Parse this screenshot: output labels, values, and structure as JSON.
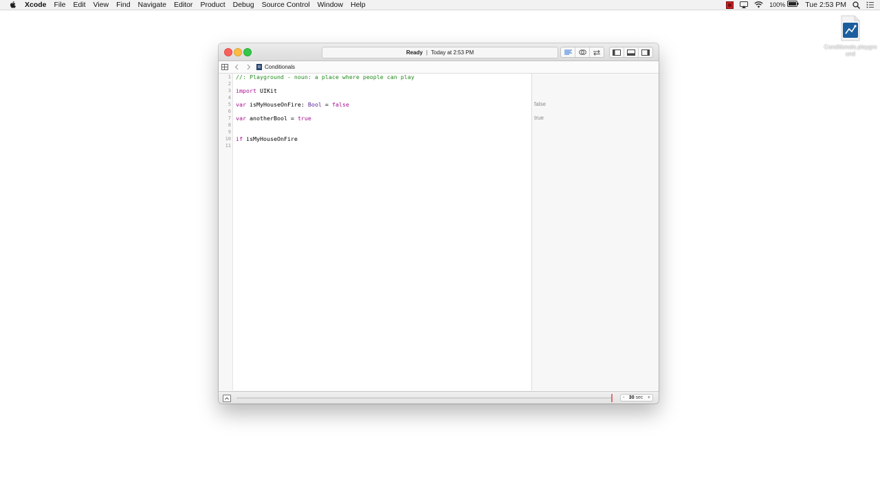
{
  "menubar": {
    "app_name": "Xcode",
    "items": [
      "File",
      "Edit",
      "View",
      "Find",
      "Navigate",
      "Editor",
      "Product",
      "Debug",
      "Source Control",
      "Window",
      "Help"
    ],
    "battery_percent": "100%",
    "clock": "Tue 2:53 PM"
  },
  "desktop": {
    "file_icon_label": "Conditionals.playground"
  },
  "window": {
    "activity": {
      "status": "Ready",
      "separator": "|",
      "time": "Today at 2:53 PM"
    },
    "jumpbar": {
      "file_name": "Conditionals"
    },
    "editor": {
      "line_numbers": [
        "1",
        "2",
        "3",
        "4",
        "5",
        "6",
        "7",
        "8",
        "9",
        "10",
        "11"
      ],
      "line1_comment": "//: Playground - noun: a place where people can play",
      "line3_kw": "import",
      "line3_rest": " UIKit",
      "line5_kw": "var",
      "line5_name": " isMyHouseOnFire: ",
      "line5_type": "Bool",
      "line5_eq": " = ",
      "line5_value": "false",
      "line7_kw": "var",
      "line7_name": " anotherBool = ",
      "line7_value": "true",
      "line10_kw": "if",
      "line10_rest": " isMyHouseOnFire"
    },
    "results": {
      "line5": "false",
      "line7": "true"
    },
    "bottombar": {
      "timer_value": "30",
      "timer_unit": " sec",
      "timer_decrement": "-",
      "timer_increment": "+"
    }
  },
  "colors": {
    "keyword": "#aa0d91",
    "comment": "#238b1e",
    "type": "#5c2699",
    "close": "#fc605c",
    "minimize": "#fdbc40",
    "zoom": "#34c84a"
  }
}
